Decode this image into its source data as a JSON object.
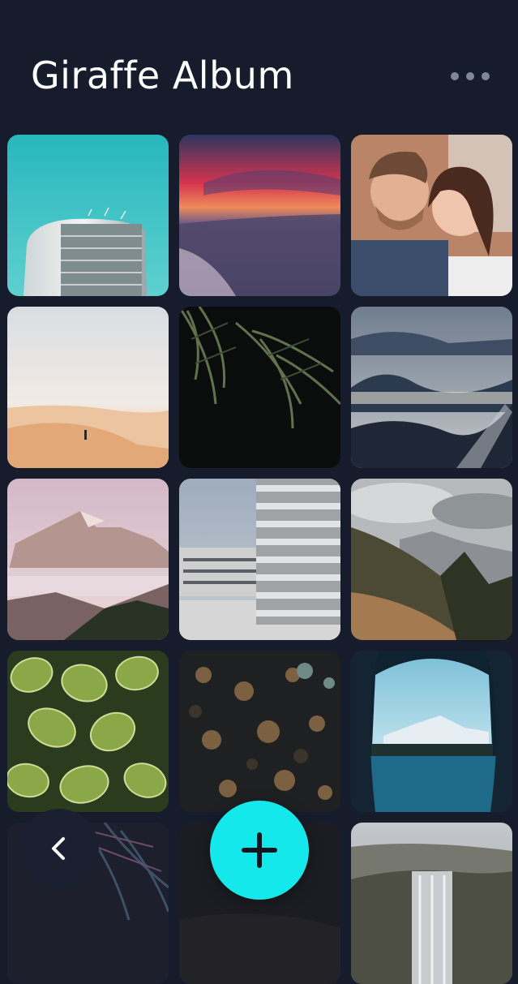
{
  "header": {
    "title": "Giraffe Album",
    "more_icon": "more-horizontal-icon"
  },
  "photos": [
    {
      "subject": "building-sky"
    },
    {
      "subject": "sunset-beach"
    },
    {
      "subject": "couple-portrait"
    },
    {
      "subject": "desert-dunes"
    },
    {
      "subject": "palm-leaves-night"
    },
    {
      "subject": "misty-mountains"
    },
    {
      "subject": "pink-mountain-peak"
    },
    {
      "subject": "modern-architecture"
    },
    {
      "subject": "cloudy-mountain-valley"
    },
    {
      "subject": "green-leaves"
    },
    {
      "subject": "aerial-forest"
    },
    {
      "subject": "cave-lake-view"
    },
    {
      "subject": "tropical-foliage"
    },
    {
      "subject": "dark-landscape"
    },
    {
      "subject": "waterfall-valley"
    }
  ],
  "actions": {
    "add_icon": "plus-icon",
    "back_icon": "chevron-left-icon"
  },
  "colors": {
    "background": "#161c2b",
    "accent": "#14e8eb",
    "back_button": "#1a2030"
  }
}
